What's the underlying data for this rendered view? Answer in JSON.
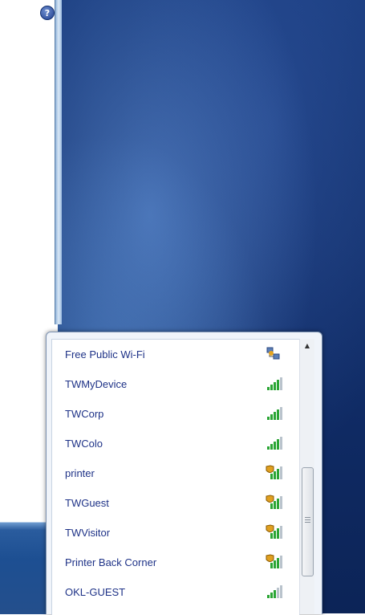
{
  "help": {
    "glyph": "?"
  },
  "networks": [
    {
      "name": "Free Public Wi-Fi",
      "icon": "adhoc-network-icon",
      "secured": false
    },
    {
      "name": "TWMyDevice",
      "icon": "signal-icon",
      "secured": false
    },
    {
      "name": "TWCorp",
      "icon": "signal-icon",
      "secured": false
    },
    {
      "name": "TWColo",
      "icon": "signal-icon",
      "secured": false
    },
    {
      "name": "printer",
      "icon": "signal-shield-icon",
      "secured": true
    },
    {
      "name": "TWGuest",
      "icon": "signal-shield-icon",
      "secured": true
    },
    {
      "name": "TWVisitor",
      "icon": "signal-shield-icon",
      "secured": true
    },
    {
      "name": "Printer Back Corner",
      "icon": "signal-shield-icon",
      "secured": true
    },
    {
      "name": "OKL-GUEST",
      "icon": "signal-icon",
      "secured": false
    }
  ],
  "scrollbar": {
    "up_glyph": "▲"
  },
  "colors": {
    "link": "#1e3287",
    "signal": "#2aa534",
    "shield": "#e0a020"
  }
}
